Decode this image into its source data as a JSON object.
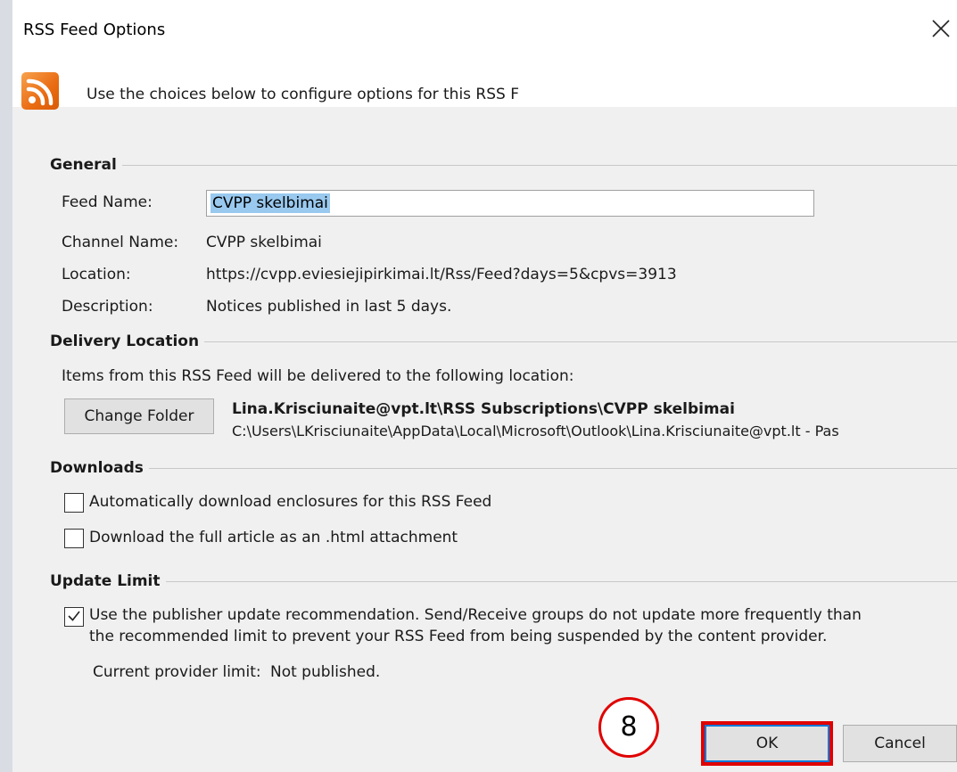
{
  "dialog": {
    "title": "RSS Feed Options",
    "header_text": "Use the choices below to configure options for this RSS F"
  },
  "general": {
    "title": "General",
    "feed_name_label": "Feed Name:",
    "feed_name_value": "CVPP skelbimai",
    "channel_name_label": "Channel Name:",
    "channel_name_value": "CVPP skelbimai",
    "location_label": "Location:",
    "location_value": "https://cvpp.eviesiejipirkimai.lt/Rss/Feed?days=5&cpvs=3913",
    "description_label": "Description:",
    "description_value": "Notices published in last 5 days."
  },
  "delivery": {
    "title": "Delivery Location",
    "intro": "Items from this RSS Feed will be delivered to the following location:",
    "change_folder_label": "Change Folder",
    "folder_path": "Lina.Krisciunaite@vpt.lt\\RSS Subscriptions\\CVPP skelbimai",
    "file_path": "C:\\Users\\LKrisciunaite\\AppData\\Local\\Microsoft\\Outlook\\Lina.Krisciunaite@vpt.lt - Pas"
  },
  "downloads": {
    "title": "Downloads",
    "auto_download_label": "Automatically download enclosures for this RSS Feed",
    "auto_download_checked": false,
    "full_article_label": "Download the full article as an .html attachment",
    "full_article_checked": false
  },
  "update_limit": {
    "title": "Update Limit",
    "use_recommendation_line1": "Use the publisher update recommendation. Send/Receive groups do not update more frequently than",
    "use_recommendation_line2": "the recommended limit to prevent your RSS Feed from being suspended by the content provider.",
    "use_recommendation_checked": true,
    "provider_limit_label": "Current provider limit:",
    "provider_limit_value": "Not published."
  },
  "buttons": {
    "ok_label": "OK",
    "cancel_label": "Cancel"
  },
  "annotation": {
    "step_number": "8"
  },
  "icons": {
    "close": "close-icon",
    "rss": "rss-icon",
    "check": "check-icon"
  },
  "colors": {
    "selection": "#99c9ef",
    "highlight": "#e00000",
    "focus": "#0078d7",
    "rss_orange": "#e96b12"
  }
}
